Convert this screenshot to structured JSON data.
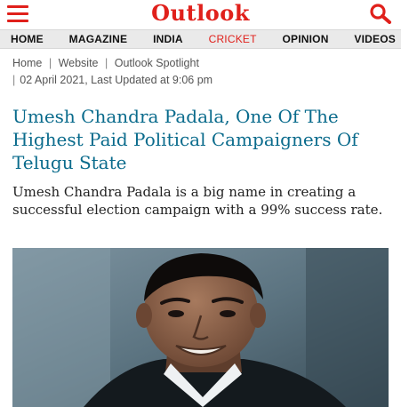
{
  "header": {
    "logo": "Outlook",
    "menu_icon": "hamburger-menu-icon",
    "search_icon": "search-icon",
    "brand_color": "#e0201b"
  },
  "nav": {
    "items": [
      {
        "label": "HOME"
      },
      {
        "label": "MAGAZINE"
      },
      {
        "label": "INDIA"
      },
      {
        "label": "CRICKET",
        "active": true
      },
      {
        "label": "OPINION"
      },
      {
        "label": "VIDEOS"
      }
    ]
  },
  "breadcrumb": {
    "items": [
      "Home",
      "Website",
      "Outlook Spotlight"
    ],
    "separator": "|"
  },
  "dateline": {
    "separator": "|",
    "text": "02 April 2021, Last Updated at 9:06 pm"
  },
  "article": {
    "title": "Umesh Chandra Padala, One Of The Highest Paid Political Campaigners Of Telugu State",
    "subtitle": "Umesh Chandra Padala is a big name in creating a successful election campaign with a 99% success rate.",
    "title_color": "#0a6b8c"
  }
}
